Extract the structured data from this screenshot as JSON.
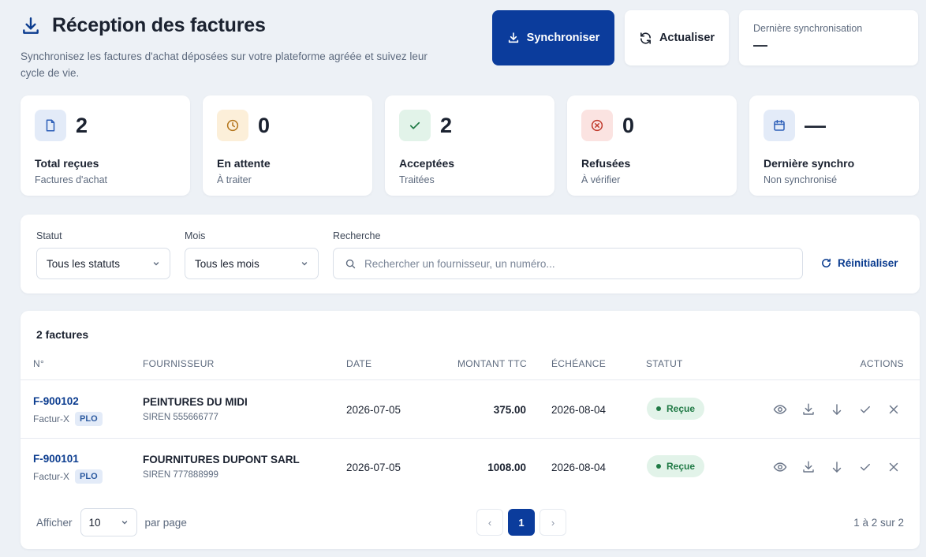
{
  "header": {
    "title": "Réception des factures",
    "subtitle": "Synchronisez les factures d'achat déposées sur votre plateforme agréée et suivez leur cycle de vie."
  },
  "toolbar": {
    "sync_label": "Synchroniser",
    "refresh_label": "Actualiser",
    "last_sync_label": "Dernière synchronisation",
    "last_sync_value": "—"
  },
  "stats": [
    {
      "value": "2",
      "label": "Total reçues",
      "sub": "Factures d'achat",
      "icon": "document-icon",
      "color": "#2d5fb8",
      "bg": "#e3ebf8"
    },
    {
      "value": "0",
      "label": "En attente",
      "sub": "À traiter",
      "icon": "clock-icon",
      "color": "#b3741a",
      "bg": "#fcefd9"
    },
    {
      "value": "2",
      "label": "Acceptées",
      "sub": "Traitées",
      "icon": "check-icon",
      "color": "#1f7a45",
      "bg": "#e2f3e9"
    },
    {
      "value": "0",
      "label": "Refusées",
      "sub": "À vérifier",
      "icon": "x-circle-icon",
      "color": "#c0392b",
      "bg": "#fbe3e1"
    },
    {
      "value": "—",
      "label": "Dernière synchro",
      "sub": "Non synchronisé",
      "icon": "calendar-icon",
      "color": "#2d5fb8",
      "bg": "#e3ebf8"
    }
  ],
  "filters": {
    "status_label": "Statut",
    "status_value": "Tous les statuts",
    "month_label": "Mois",
    "month_value": "Tous les mois",
    "search_label": "Recherche",
    "search_placeholder": "Rechercher un fournisseur, un numéro...",
    "reset_label": "Réinitialiser"
  },
  "table": {
    "count_label": "2 factures",
    "columns": [
      "N°",
      "FOURNISSEUR",
      "DATE",
      "MONTANT TTC",
      "ÉCHÉANCE",
      "STATUT",
      "ACTIONS"
    ],
    "rows": [
      {
        "number": "F-900102",
        "format": "Factur-X",
        "tag": "PLO",
        "supplier": "PEINTURES DU MIDI",
        "siren": "SIREN 555666777",
        "date": "2026-07-05",
        "amount": "375.00",
        "due": "2026-08-04",
        "status": "Reçue"
      },
      {
        "number": "F-900101",
        "format": "Factur-X",
        "tag": "PLO",
        "supplier": "FOURNITURES DUPONT SARL",
        "siren": "SIREN 777888999",
        "date": "2026-07-05",
        "amount": "1008.00",
        "due": "2026-08-04",
        "status": "Reçue"
      }
    ]
  },
  "pagination": {
    "show_label": "Afficher",
    "per_page_value": "10",
    "per_page_label": "par page",
    "prev": "‹",
    "current_page": "1",
    "next": "›",
    "range": "1 à 2 sur 2"
  }
}
